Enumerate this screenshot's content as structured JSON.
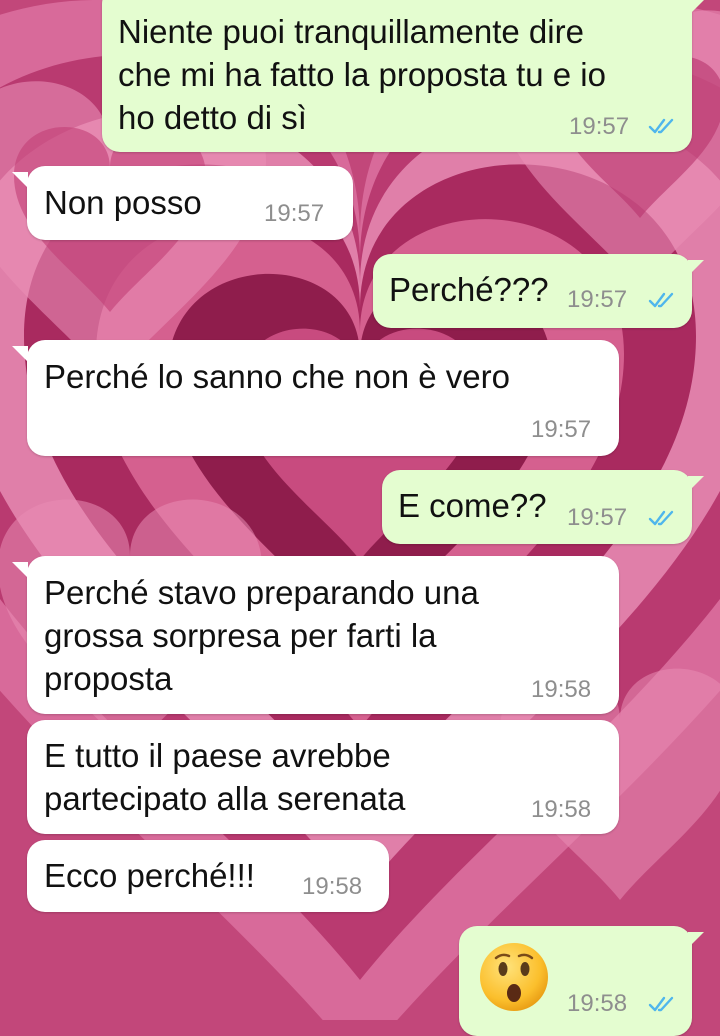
{
  "colors": {
    "outgoing_bubble": "#e4fdd0",
    "incoming_bubble": "#ffffff",
    "read_ticks": "#4fb6ec",
    "timestamp": "#8e8e8e",
    "wallpaper": "#c2477a"
  },
  "wallpaper": {
    "icon": "concentric-hearts-pattern"
  },
  "messages": [
    {
      "direction": "outgoing",
      "text": "Niente puoi tranquillamente dire\nche mi ha fatto la proposta tu e io\nho detto di sì",
      "time": "19:57",
      "status": "read"
    },
    {
      "direction": "incoming",
      "text": "Non posso",
      "time": "19:57"
    },
    {
      "direction": "outgoing",
      "text": "Perché???",
      "time": "19:57",
      "status": "read"
    },
    {
      "direction": "incoming",
      "text": "Perché lo sanno che non è vero",
      "time": "19:57"
    },
    {
      "direction": "outgoing",
      "text": "E come??",
      "time": "19:57",
      "status": "read"
    },
    {
      "direction": "incoming",
      "text": "Perché stavo preparando una\ngrossa sorpresa per farti la\nproposta",
      "time": "19:58"
    },
    {
      "direction": "incoming",
      "text": "E tutto il paese avrebbe\npartecipato alla serenata",
      "time": "19:58"
    },
    {
      "direction": "incoming",
      "text": "Ecco perché!!!",
      "time": "19:58"
    },
    {
      "direction": "outgoing",
      "text": "",
      "emoji": "hushed-face-emoji",
      "time": "19:58",
      "status": "read"
    }
  ]
}
